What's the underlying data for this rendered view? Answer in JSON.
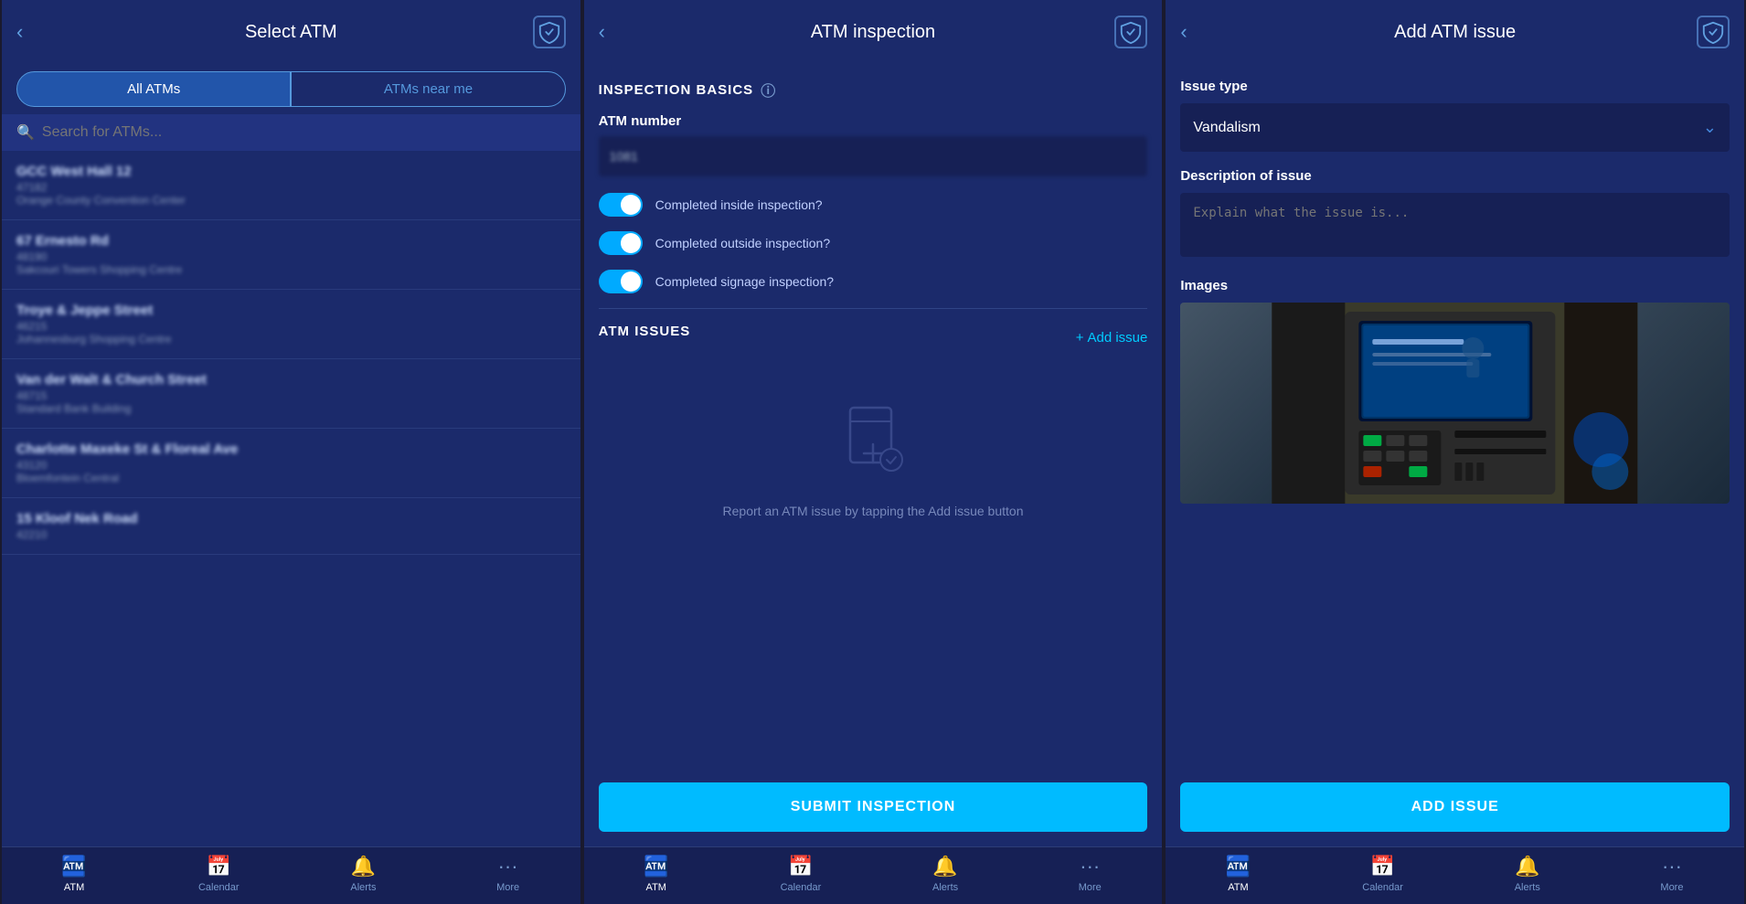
{
  "screen1": {
    "title": "Select ATM",
    "back_icon": "‹",
    "tab_all": "All ATMs",
    "tab_near": "ATMs near me",
    "search_placeholder": "Search for ATMs...",
    "atm_list": [
      {
        "name": "GCC West Hall 12",
        "id": "47182",
        "sub": "Orange County Convention Center"
      },
      {
        "name": "67 Ernesto Rd",
        "id": "48190",
        "sub": "Sakcouri Towers Shopping Centre"
      },
      {
        "name": "Troye & Jeppe Street",
        "id": "46215",
        "sub": "Johannesburg Shopping Centre"
      },
      {
        "name": "Van der Walt & Church Street",
        "id": "48715",
        "sub": "Standard Bank Building"
      },
      {
        "name": "Charlotte Maxeke St & Floreal Ave",
        "id": "43120",
        "sub": "Bloemfontein Central"
      },
      {
        "name": "15 Kloof Nek Road",
        "id": "42210",
        "sub": ""
      }
    ],
    "nav": {
      "atm": "ATM",
      "calendar": "Calendar",
      "alerts": "Alerts",
      "more": "More"
    }
  },
  "screen2": {
    "title": "ATM inspection",
    "back_icon": "‹",
    "section_basics": "INSPECTION BASICS",
    "atm_number_label": "ATM number",
    "atm_number_value": "1081",
    "toggle1_label": "Completed inside inspection?",
    "toggle2_label": "Completed outside inspection?",
    "toggle3_label": "Completed signage inspection?",
    "section_issues": "ATM ISSUES",
    "add_issue_label": "Add issue",
    "add_issue_icon": "+",
    "empty_text": "Report an ATM issue by\ntapping the Add issue button",
    "submit_btn": "SUBMIT INSPECTION",
    "nav": {
      "atm": "ATM",
      "calendar": "Calendar",
      "alerts": "Alerts",
      "more": "More"
    }
  },
  "screen3": {
    "title": "Add ATM issue",
    "back_icon": "‹",
    "issue_type_label": "Issue type",
    "issue_type_value": "Vandalism",
    "description_label": "Description of issue",
    "description_placeholder": "Explain what the issue is...",
    "images_label": "Images",
    "submit_btn": "ADD ISSUE",
    "nav": {
      "atm": "ATM",
      "calendar": "Calendar",
      "alerts": "Alerts",
      "more": "More"
    }
  }
}
